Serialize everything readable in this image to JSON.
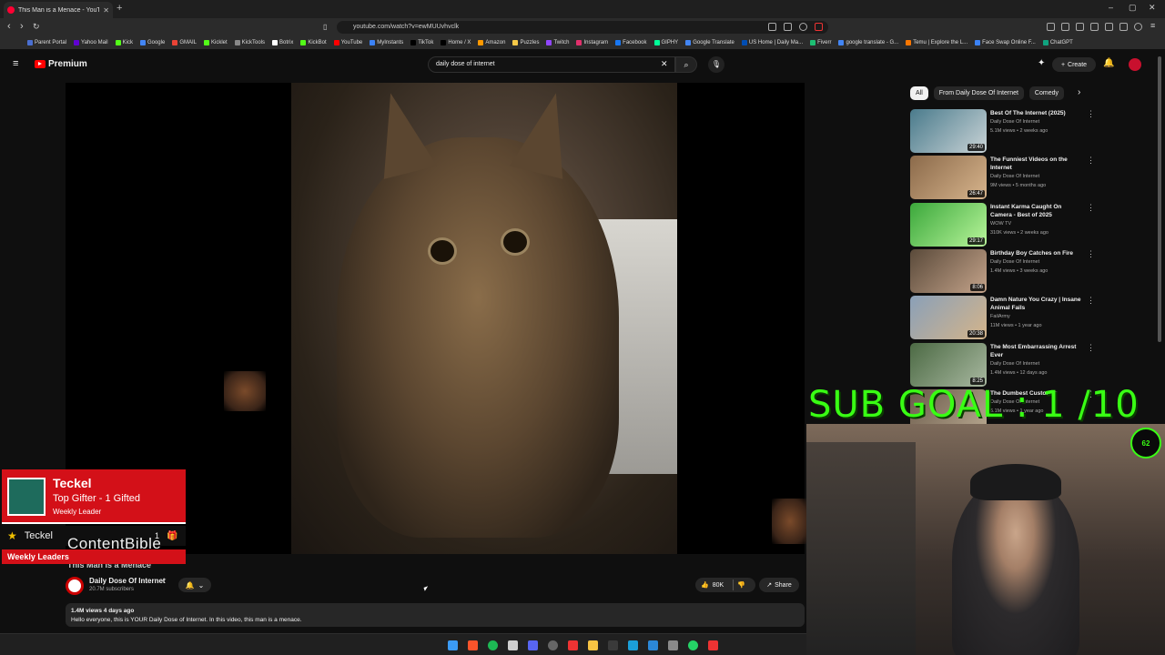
{
  "browser": {
    "tab_title": "This Man is a Menace - YouT",
    "new_tab": "+",
    "url": "youtube.com/watch?v=ewMUUvhvclk",
    "win_min": "–",
    "win_max": "▢",
    "win_close": "✕",
    "bookmarks": [
      {
        "label": "Parent Portal",
        "color": "#4a6fd1"
      },
      {
        "label": "Yahoo Mail",
        "color": "#6001d2"
      },
      {
        "label": "Kick",
        "color": "#53fc18"
      },
      {
        "label": "Google",
        "color": "#4285f4"
      },
      {
        "label": "GMAIL",
        "color": "#ea4335"
      },
      {
        "label": "Kicklet",
        "color": "#53fc18"
      },
      {
        "label": "KickTools",
        "color": "#888888"
      },
      {
        "label": "Botrix",
        "color": "#ffffff"
      },
      {
        "label": "KickBot",
        "color": "#53fc18"
      },
      {
        "label": "YouTube",
        "color": "#ff0000"
      },
      {
        "label": "MyInstants",
        "color": "#3b82f6"
      },
      {
        "label": "TikTok",
        "color": "#000000"
      },
      {
        "label": "Home / X",
        "color": "#000000"
      },
      {
        "label": "Amazon",
        "color": "#ff9900"
      },
      {
        "label": "Puzzles",
        "color": "#f7c948"
      },
      {
        "label": "Twitch",
        "color": "#9146ff"
      },
      {
        "label": "Instagram",
        "color": "#e1306c"
      },
      {
        "label": "Facebook",
        "color": "#1877f2"
      },
      {
        "label": "GIPHY",
        "color": "#00ff99"
      },
      {
        "label": "Google Translate",
        "color": "#4285f4"
      },
      {
        "label": "US Home | Daily Ma...",
        "color": "#004db3"
      },
      {
        "label": "Fiverr",
        "color": "#1dbf73"
      },
      {
        "label": "google translate - G...",
        "color": "#4285f4"
      },
      {
        "label": "Temu | Explore the L...",
        "color": "#fb7701"
      },
      {
        "label": "Face Swap Online F...",
        "color": "#3b82f6"
      },
      {
        "label": "ChatGPT",
        "color": "#10a37f"
      }
    ]
  },
  "youtube": {
    "logo_text": "Premium",
    "search_value": "daily dose of internet",
    "create_label": "Create",
    "video_title": "This Man is a Menace",
    "channel_name": "Daily Dose Of Internet",
    "subscribers": "20.7M subscribers",
    "likes": "80K",
    "share_label": "Share",
    "views_date": "1.4M views  4 days ago",
    "description": "Hello everyone, this is YOUR Daily Dose of Internet. In this video, this man is a menace.",
    "chips": [
      "All",
      "From Daily Dose Of Internet",
      "Comedy"
    ],
    "recommendations": [
      {
        "title": "Best Of The Internet (2025)",
        "channel": "Daily Dose Of Internet",
        "meta": "5.1M views • 2 weeks ago",
        "duration": "29:40",
        "colors": [
          "#4a7b8c",
          "#c9d3d6"
        ]
      },
      {
        "title": "The Funniest Videos on the Internet",
        "channel": "Daily Dose Of Internet",
        "meta": "9M views • 5 months ago",
        "duration": "26:47",
        "colors": [
          "#8b6a4a",
          "#d7b48c"
        ]
      },
      {
        "title": "Instant Karma Caught On Camera - Best of 2025",
        "channel": "WOW TV",
        "meta": "310K views • 2 weeks ago",
        "duration": "29:17",
        "colors": [
          "#3ba83b",
          "#b9f59b"
        ]
      },
      {
        "title": "Birthday Boy Catches on Fire",
        "channel": "Daily Dose Of Internet",
        "meta": "1.4M views • 3 weeks ago",
        "duration": "8:06",
        "colors": [
          "#5a4a3a",
          "#c4a38a"
        ]
      },
      {
        "title": "Damn Nature You Crazy | Insane Animal Fails",
        "channel": "FailArmy",
        "meta": "11M views • 1 year ago",
        "duration": "20:38",
        "colors": [
          "#8aa0b8",
          "#d4b48a"
        ]
      },
      {
        "title": "The Most Embarrassing Arrest Ever",
        "channel": "Daily Dose Of Internet",
        "meta": "1.4M views • 12 days ago",
        "duration": "8:25",
        "colors": [
          "#4c6a44",
          "#a8b8a0"
        ]
      },
      {
        "title": "The Dumbest Customer",
        "channel": "Daily Dose Of Internet",
        "meta": "6.1M views • 1 year ago",
        "duration": "",
        "colors": [
          "#6a5a4a",
          "#b8a890"
        ]
      }
    ]
  },
  "overlays": {
    "sub_goal": "SUB GOAL : 1  /10",
    "gifter_name": "Teckel",
    "gifter_line": "Top Gifter - 1 Gifted",
    "gifter_sub": "Weekly Leader",
    "leader_name": "Teckel",
    "leader_count": "1",
    "weekly_leaders": "Weekly Leaders",
    "content_bible": "ContentBible",
    "badge": "62"
  }
}
